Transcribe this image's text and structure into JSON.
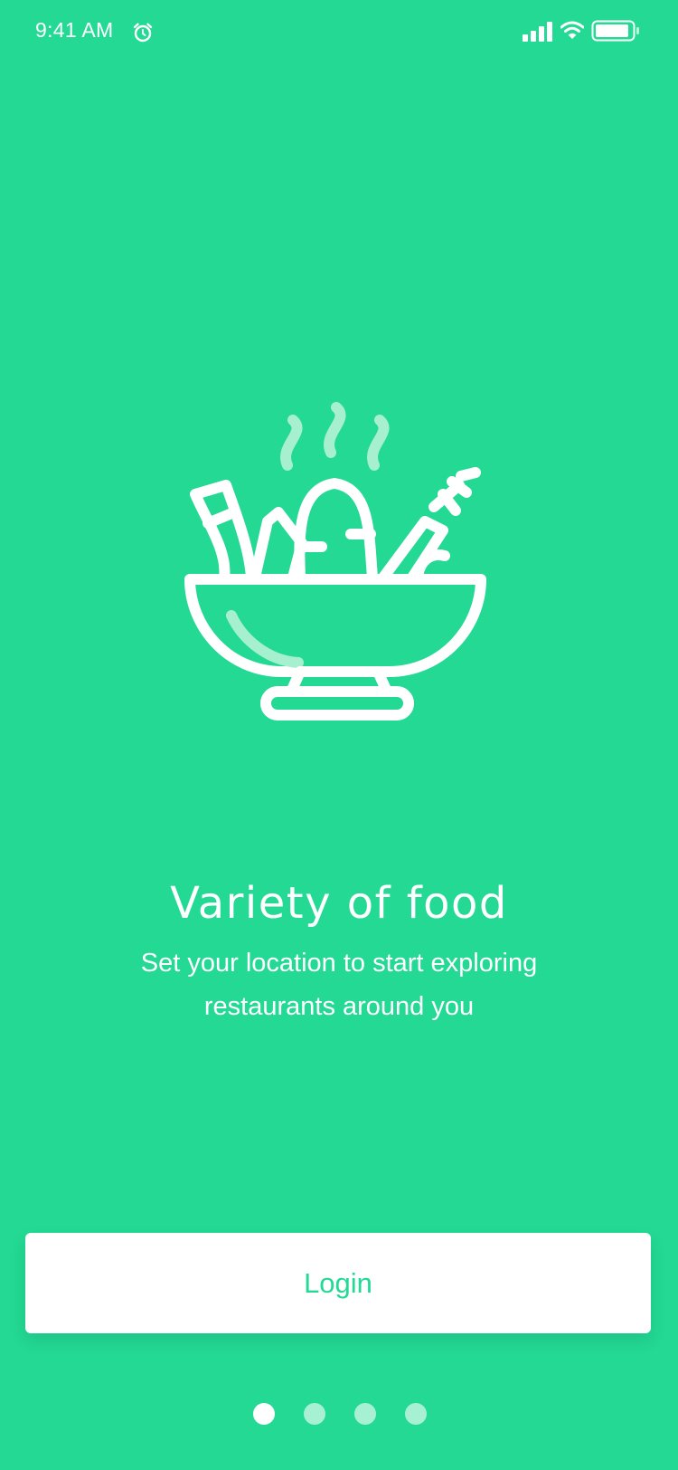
{
  "status_bar": {
    "time": "9:41 AM",
    "icons": [
      "alarm-icon",
      "signal-icon",
      "wifi-icon",
      "battery-icon"
    ]
  },
  "illustration": {
    "icon": "food-bowl-illustration"
  },
  "onboarding": {
    "title": "Variety of food",
    "subtitle": "Set your location to start exploring restaurants around you"
  },
  "login_button": {
    "label": "Login"
  },
  "pager": {
    "total": 4,
    "active_index": 0
  },
  "colors": {
    "background": "#23d994",
    "accent": "#23d994",
    "white": "#ffffff"
  }
}
